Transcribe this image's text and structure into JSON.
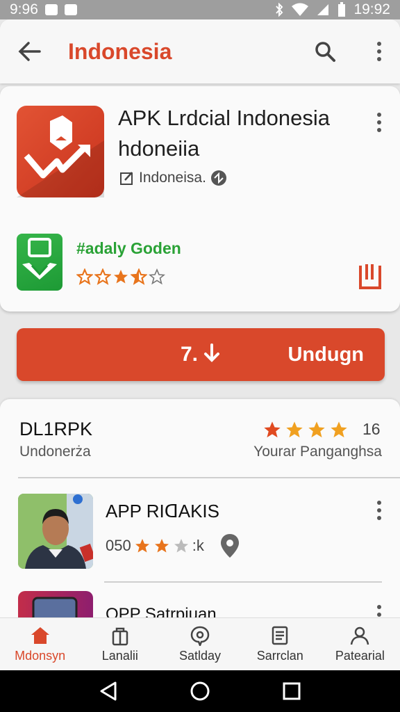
{
  "status_bar": {
    "time_left": "9:96",
    "time_right": "19:92"
  },
  "app_bar": {
    "title": "Indonesia"
  },
  "app_card": {
    "title": "APK Lrdcial Indonesia hdoneiia",
    "publisher": "Indoneisa.",
    "sub_title": "#adaly Goden",
    "rating_stars": 3.5
  },
  "download": {
    "size": "7.",
    "label": "Undugn"
  },
  "reviews": {
    "title": "DL1RPK",
    "subtitle": "Undonerża",
    "stars": 4,
    "count": "16",
    "label": "Yourar Panganghsa"
  },
  "list": [
    {
      "title": "APP RIᗡAKIS",
      "meta_prefix": "050",
      "meta_suffix": ":k",
      "stars": 2
    },
    {
      "title": "OPP Satrpiuan"
    }
  ],
  "bottom_nav": [
    {
      "label": "Mdonsyn",
      "icon": "home-icon",
      "active": true
    },
    {
      "label": "Lanalii",
      "icon": "bag-icon"
    },
    {
      "label": "Satlday",
      "icon": "chat-icon"
    },
    {
      "label": "Sarrclan",
      "icon": "document-icon"
    },
    {
      "label": "Patearial",
      "icon": "person-icon"
    }
  ],
  "colors": {
    "accent": "#d9482b",
    "green": "#2aa236",
    "star": "#e8741c"
  }
}
